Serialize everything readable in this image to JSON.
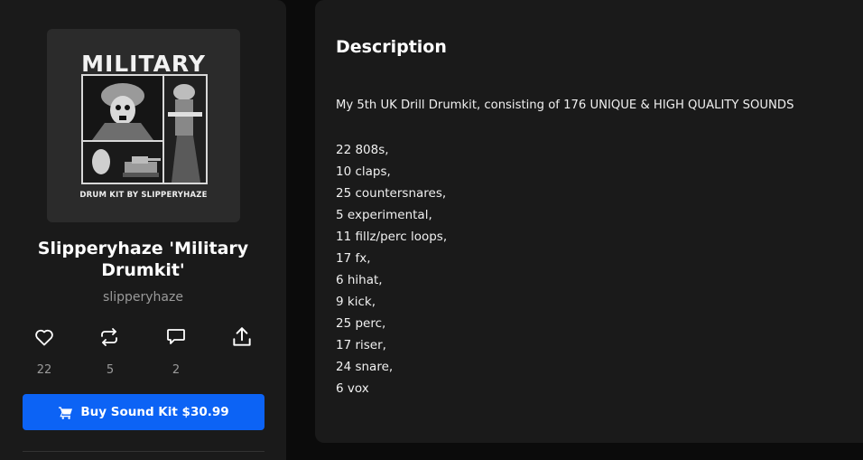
{
  "product": {
    "cover": {
      "title": "MILITARY",
      "subtitle": "DRUM KIT BY SLIPPERYHAZE"
    },
    "title": "Slipperyhaze 'Military Drumkit'",
    "author": "slipperyhaze",
    "actions": [
      {
        "icon": "heart-icon",
        "count": "22"
      },
      {
        "icon": "repost-icon",
        "count": "5"
      },
      {
        "icon": "comment-icon",
        "count": "2"
      },
      {
        "icon": "share-icon",
        "count": ""
      }
    ],
    "buy_button_label": "Buy Sound Kit $30.99",
    "accent_color": "#0c63f5"
  },
  "description": {
    "heading": "Description",
    "intro": "My 5th UK Drill Drumkit, consisting of 176 UNIQUE & HIGH QUALITY SOUNDS",
    "items": [
      "22 808s,",
      "10 claps,",
      "25 countersnares,",
      "5 experimental,",
      "11 fillz/perc loops,",
      "17 fx,",
      "6 hihat,",
      "9 kick,",
      "25 perc,",
      "17 riser,",
      "24 snare,",
      "6 vox"
    ]
  }
}
